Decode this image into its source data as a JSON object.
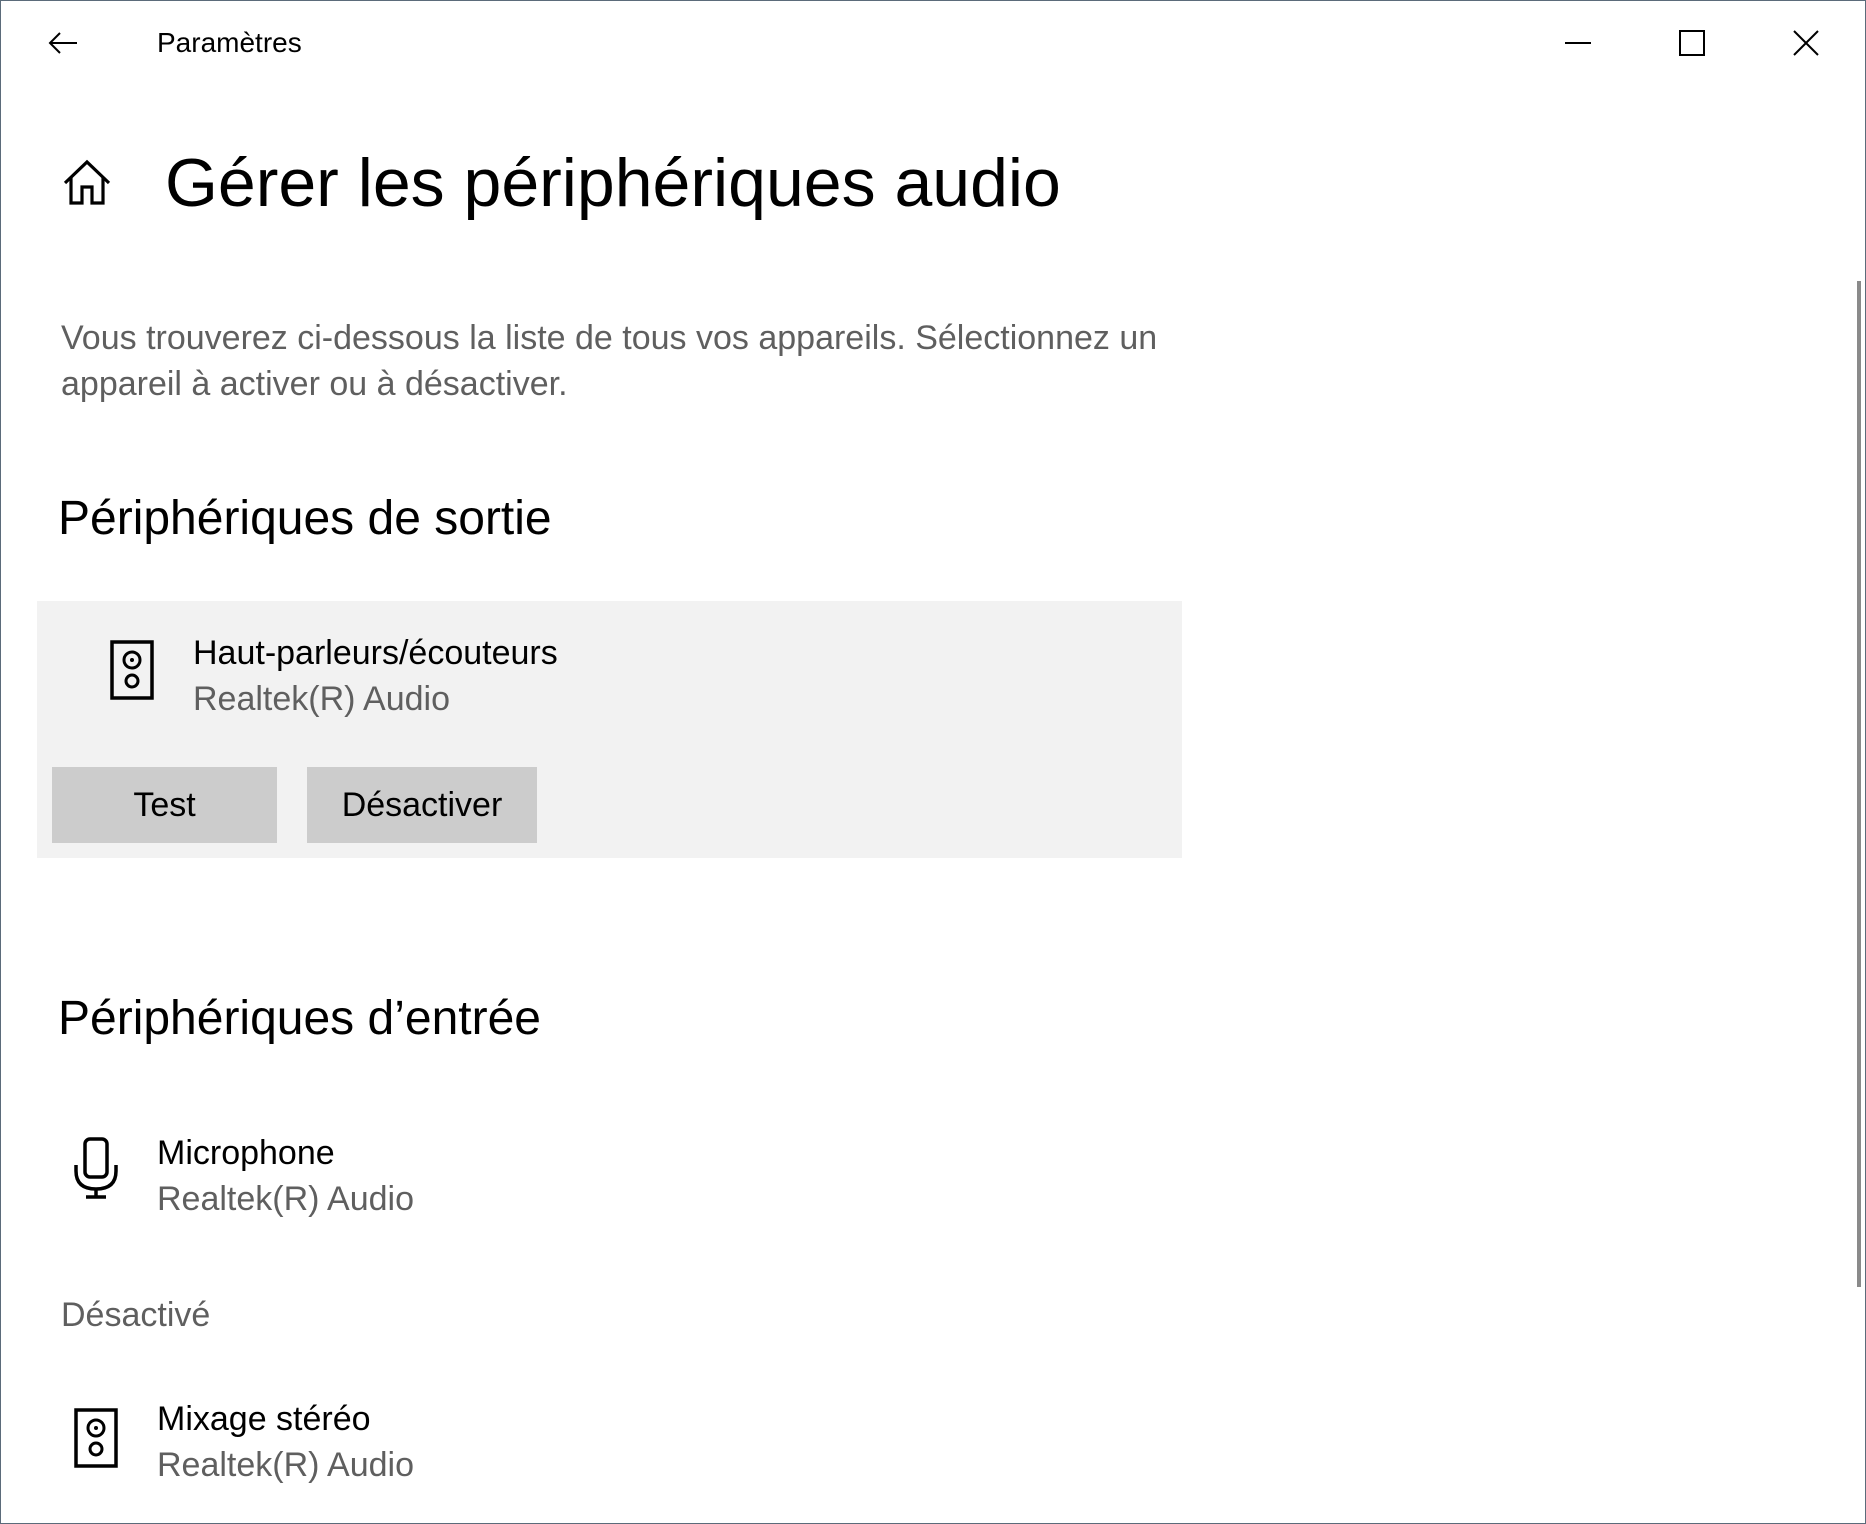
{
  "titlebar": {
    "app_title": "Paramètres",
    "back_icon": "arrow-left-icon",
    "minimize_icon": "minimize-icon",
    "maximize_icon": "maximize-icon",
    "close_icon": "close-icon"
  },
  "header": {
    "home_icon": "home-icon",
    "title": "Gérer les périphériques audio",
    "description": "Vous trouverez ci-dessous la liste de tous vos appareils. Sélectionnez un appareil à activer ou à désactiver."
  },
  "output": {
    "section_title": "Périphériques de sortie",
    "devices": [
      {
        "icon": "speaker-icon",
        "name": "Haut-parleurs/écouteurs",
        "driver": "Realtek(R) Audio",
        "test_label": "Test",
        "disable_label": "Désactiver"
      }
    ]
  },
  "input": {
    "section_title": "Périphériques d’entrée",
    "devices": [
      {
        "icon": "microphone-icon",
        "name": "Microphone",
        "driver": "Realtek(R) Audio"
      }
    ],
    "disabled_label": "Désactivé",
    "disabled_devices": [
      {
        "icon": "speaker-icon",
        "name": "Mixage stéréo",
        "driver": "Realtek(R) Audio"
      }
    ]
  },
  "colors": {
    "card_background": "#f2f2f2",
    "button_background": "#cccccc",
    "secondary_text": "#5f5f5f"
  }
}
